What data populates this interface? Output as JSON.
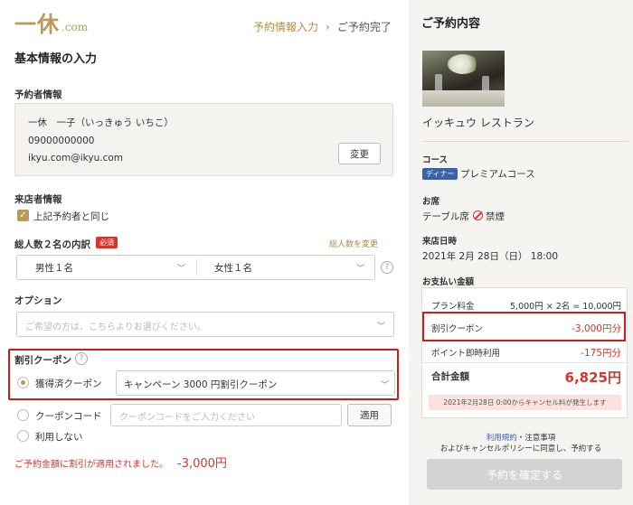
{
  "header": {
    "logo_main": "一休",
    "logo_suffix": ".com",
    "step_current": "予約情報入力",
    "step_sep": "›",
    "step_next": "ご予約完了"
  },
  "page_title": "基本情報の入力",
  "booker": {
    "label": "予約者情報",
    "name": "一休　一子（いっきゅう いちこ）",
    "phone": "09000000000",
    "email": "ikyu.com@ikyu.com",
    "change_button": "変更"
  },
  "visitor": {
    "label": "来店者情報",
    "same_checkbox_label": "上記予約者と同じ",
    "checked": true
  },
  "party": {
    "label": "総人数２名の内訳",
    "required_badge": "必須",
    "change_link": "総人数を変更",
    "male_value": "男性１名",
    "female_value": "女性１名",
    "help_glyph": "?"
  },
  "option": {
    "label": "オプション",
    "placeholder": "ご希望の方は、こちらよりお選びください。"
  },
  "coupon": {
    "label": "割引クーポン",
    "help_glyph": "?",
    "acquired_label": "獲得済クーポン",
    "acquired_value": "キャンペーン 3000 円割引クーポン",
    "code_label": "クーポンコード",
    "code_placeholder": "クーポンコードをご入力ください",
    "apply_button": "適用",
    "none_label": "利用しない",
    "selected": "acquired",
    "applied_message": "ご予約金額に割引が適用されました。",
    "applied_amount": "-3,000円"
  },
  "summary": {
    "title": "ご予約内容",
    "restaurant": "イッキュウ レストラン",
    "course_label": "コース",
    "course_tag": "ディナー",
    "course_name": "プレミアムコース",
    "seat_label": "お席",
    "seat_value": "テーブル席",
    "smoking": "禁煙",
    "datetime_label": "来店日時",
    "datetime_value": "2021年 2月 28日（日） 18:00",
    "payment_label": "お支払い金額",
    "plan_label": "プラン料金",
    "plan_value": "5,000円 × 2名 = 10,000円",
    "coupon_label": "割引クーポン",
    "coupon_value": "-3,000円分",
    "points_label": "ポイント即時利用",
    "points_value": "-175円分",
    "total_label": "合計金額",
    "total_value": "6,825円",
    "cancel_note": "2021年2月28日 0:00からキャンセル料が発生します",
    "terms_link": "利用規約",
    "terms_sep": "・",
    "terms_notes": "注意事項",
    "terms_line2": "およびキャンセルポリシーに同意し、予約する",
    "confirm_button": "予約を確定する"
  },
  "colors": {
    "gold": "#b79a56",
    "red": "#d9342b",
    "highlight": "#d11a1a",
    "blue": "#3a62a6"
  }
}
